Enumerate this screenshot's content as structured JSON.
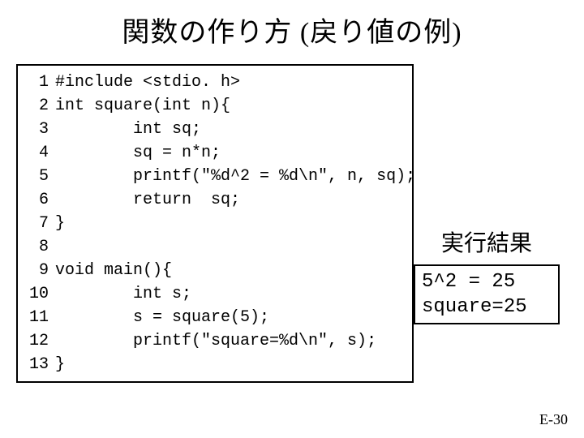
{
  "title": "関数の作り方 (戻り値の例)",
  "code": {
    "lines": [
      {
        "n": "1",
        "t": "#include <stdio. h>"
      },
      {
        "n": "2",
        "t": "int square(int n){"
      },
      {
        "n": "3",
        "t": "        int sq;"
      },
      {
        "n": "4",
        "t": "        sq = n*n;"
      },
      {
        "n": "5",
        "t": "        printf(\"%d^2 = %d\\n\", n, sq);"
      },
      {
        "n": "6",
        "t": "        return  sq;"
      },
      {
        "n": "7",
        "t": "}"
      },
      {
        "n": "8",
        "t": ""
      },
      {
        "n": "9",
        "t": "void main(){"
      },
      {
        "n": "10",
        "t": "        int s;"
      },
      {
        "n": "11",
        "t": "        s = square(5);"
      },
      {
        "n": "12",
        "t": "        printf(\"square=%d\\n\", s);"
      },
      {
        "n": "13",
        "t": "}"
      }
    ]
  },
  "result": {
    "label": "実行結果",
    "output": "5^2 = 25\nsquare=25"
  },
  "footer": "E-30"
}
